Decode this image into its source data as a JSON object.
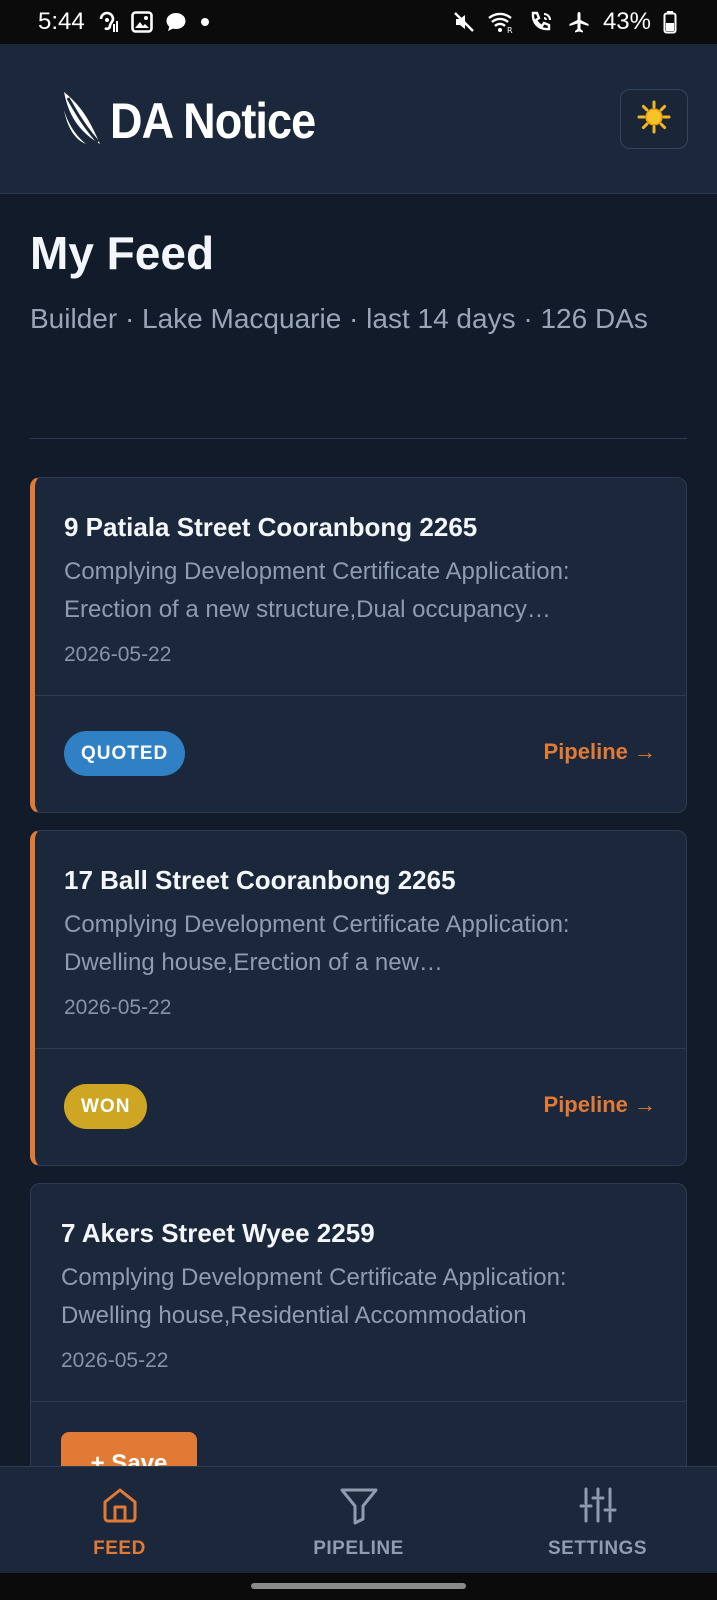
{
  "status_bar": {
    "time": "5:44",
    "battery": "43%",
    "left_icons": [
      "hearing-icon",
      "image-icon",
      "chat-bubble-icon",
      "dot-icon"
    ],
    "right_icons": [
      "mute-icon",
      "wifi-calling-icon",
      "phone-wifi-icon",
      "airplane-icon",
      "battery-icon"
    ]
  },
  "header": {
    "app_name": "DA Notice",
    "logo_icon": "leaf-icon",
    "theme_icon": "sun-icon"
  },
  "feed": {
    "title": "My Feed",
    "subtitle": "Builder · Lake Macquarie · last 14 days · 126 DAs"
  },
  "cards": [
    {
      "address": "9 Patiala Street Cooranbong 2265",
      "description_line1": "Complying Development Certificate Application:",
      "description_line2": "Erection of a new structure,Dual occupancy…",
      "date": "2026-05-22",
      "status": "QUOTED",
      "status_color": "#2f80c4",
      "action": "Pipeline →"
    },
    {
      "address": "17 Ball Street Cooranbong 2265",
      "description_line1": "Complying Development Certificate Application:",
      "description_line2": "Dwelling house,Erection of a new…",
      "date": "2026-05-22",
      "status": "WON",
      "status_color": "#cfa623",
      "action": "Pipeline →"
    },
    {
      "address": "7 Akers Street Wyee 2259",
      "description_line1": "Complying Development Certificate Application:",
      "description_line2": "Dwelling house,Residential Accommodation",
      "date": "2026-05-22",
      "action": "+ Save"
    }
  ],
  "nav": {
    "feed": "FEED",
    "pipeline": "PIPELINE",
    "settings": "SETTINGS",
    "active": "feed",
    "accent_color": "#e07a35"
  }
}
